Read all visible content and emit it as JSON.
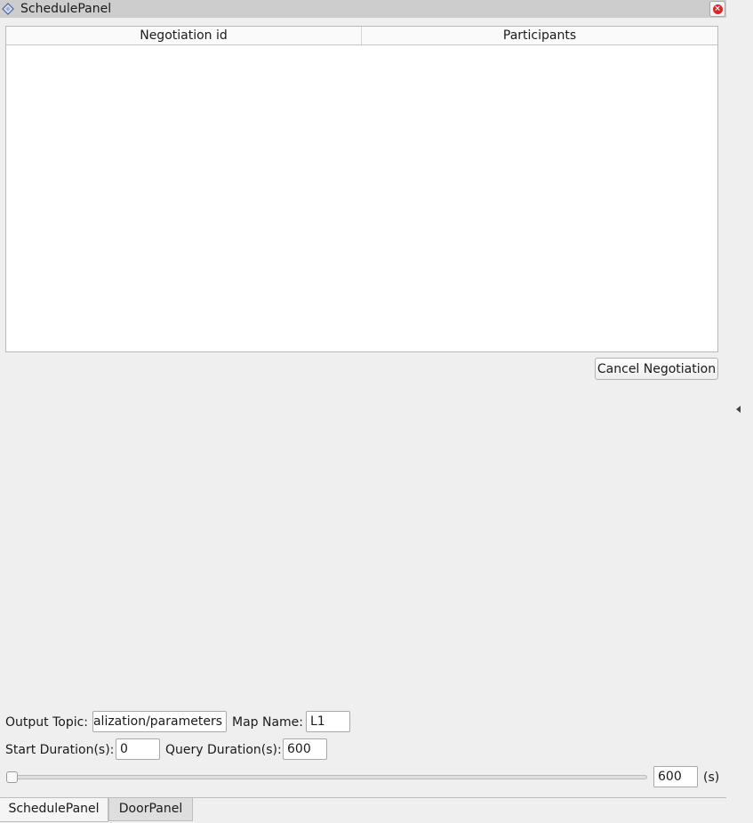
{
  "window": {
    "title": "SchedulePanel",
    "icon": "diamond-icon",
    "close_icon": "close-icon"
  },
  "table": {
    "columns": [
      "Negotiation id",
      "Participants"
    ],
    "rows": []
  },
  "actions": {
    "cancel_negotiation": "Cancel Negotiation"
  },
  "form": {
    "output_topic_label": "Output Topic:",
    "output_topic_value": "alization/parameters",
    "map_name_label": "Map Name:",
    "map_name_value": "L1",
    "start_duration_label": "Start Duration(s):",
    "start_duration_value": "0",
    "query_duration_label": "Query Duration(s):",
    "query_duration_value": "600"
  },
  "slider": {
    "value": 0,
    "field_value": "600",
    "unit": "(s)"
  },
  "tabs": [
    {
      "label": "SchedulePanel",
      "active": true
    },
    {
      "label": "DoorPanel",
      "active": false
    }
  ],
  "colors": {
    "close": "#d42a2a",
    "background": "#efefef"
  }
}
